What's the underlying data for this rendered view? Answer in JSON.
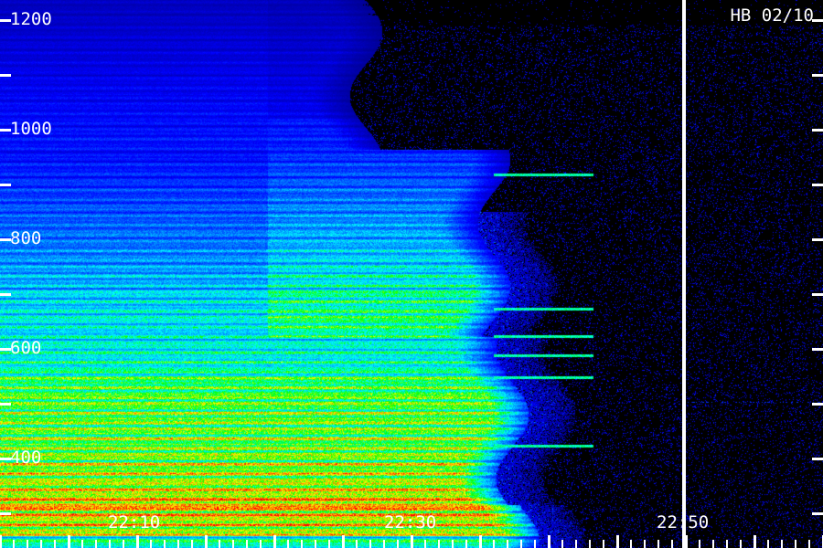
{
  "station_label": "HB 02/10",
  "chart_data": {
    "type": "heatmap",
    "title": "",
    "xlabel": "",
    "ylabel": "",
    "x_tick_labels": [
      "22:10",
      "22:30",
      "22:50"
    ],
    "y_tick_labels": [
      "1200",
      "1000",
      "800",
      "600",
      "400"
    ],
    "x_range": [
      "22:02",
      "22:60"
    ],
    "y_range": [
      360,
      1240
    ],
    "colormap": [
      "#00007f",
      "#0000ff",
      "#0080ff",
      "#00ffff",
      "#00ff00",
      "#ffff00",
      "#ff8000",
      "#ff0000"
    ],
    "marker_time": "22:49.9",
    "regions": [
      {
        "name": "vertical-band-change",
        "time": "22:20.5"
      },
      {
        "name": "main-emission",
        "t_start": "22:02",
        "t_end": "22:37",
        "f_low": 360,
        "f_high": 1000,
        "peak_f": 420
      },
      {
        "name": "discrete-lines",
        "freqs": [
          960,
          745,
          700,
          670,
          635,
          525
        ],
        "t_start": "22:37",
        "t_end": "22:44"
      }
    ]
  }
}
